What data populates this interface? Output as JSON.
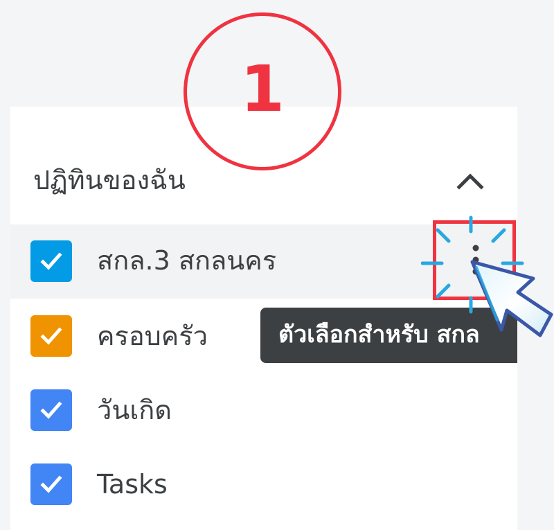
{
  "step_badge": {
    "number": "1"
  },
  "section": {
    "title": "ปฏิทินของฉัน",
    "collapse_icon": "chevron-up-icon"
  },
  "calendars": [
    {
      "label": "สกล.3 สกลนคร",
      "checked": true,
      "color": "#039be5"
    },
    {
      "label": "ครอบครัว",
      "checked": true,
      "color": "#f09300"
    },
    {
      "label": "วันเกิด",
      "checked": true,
      "color": "#4285f4"
    },
    {
      "label": "Tasks",
      "checked": true,
      "color": "#4285f4"
    }
  ],
  "options_button": {
    "icon": "more-vertical-icon"
  },
  "tooltip": {
    "text": "ตัวเลือกสำหรับ สกล"
  },
  "colors": {
    "highlight": "#ef3340",
    "tooltip_bg": "#3c4043",
    "hover_row": "#f1f3f4",
    "sparkle": "#29a8e0",
    "cursor_outline": "#3a57a8"
  }
}
